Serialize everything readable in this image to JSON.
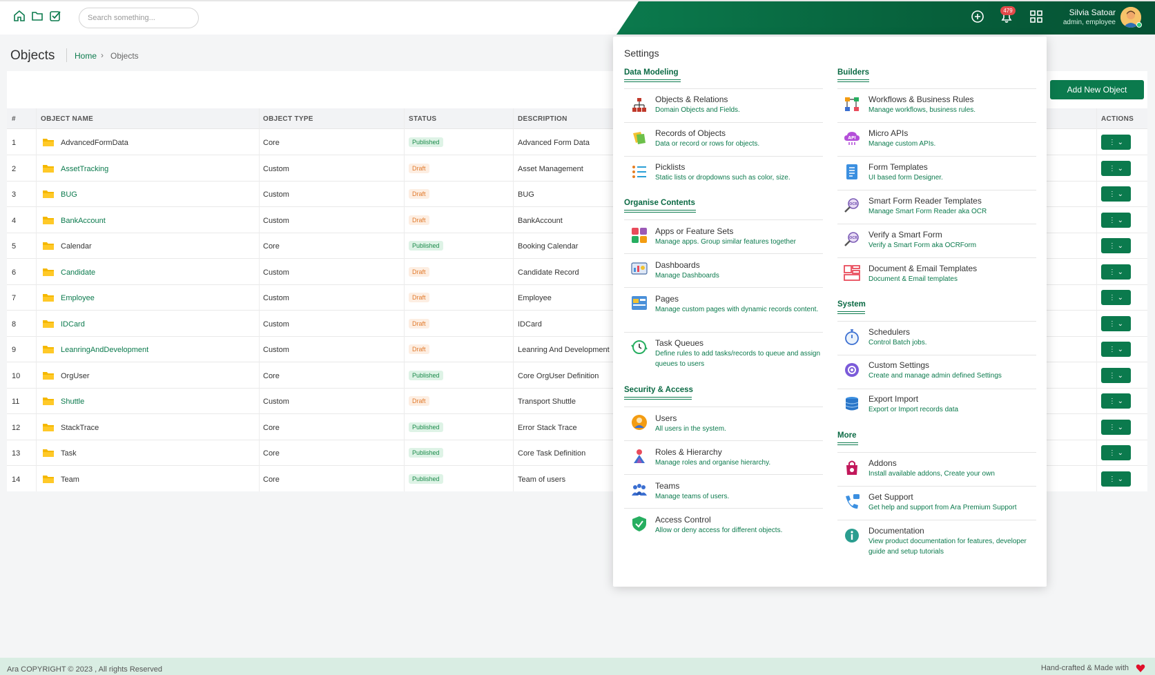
{
  "header": {
    "search_placeholder": "Search something...",
    "notification_count": "479",
    "user_name": "Silvia Satoar",
    "user_role": "admin, employee"
  },
  "page": {
    "title": "Objects",
    "breadcrumb_home": "Home",
    "breadcrumb_sep": "›",
    "breadcrumb_current": "Objects",
    "add_button": "Add New Object"
  },
  "table": {
    "columns": [
      "#",
      "OBJECT NAME",
      "OBJECT TYPE",
      "STATUS",
      "DESCRIPTION",
      "ACTIONS"
    ],
    "rows": [
      {
        "num": "1",
        "name": "AdvancedFormData",
        "type": "Core",
        "status": "Published",
        "desc": "Advanced Form Data"
      },
      {
        "num": "2",
        "name": "AssetTracking",
        "type": "Custom",
        "status": "Draft",
        "desc": "Asset Management"
      },
      {
        "num": "3",
        "name": "BUG",
        "type": "Custom",
        "status": "Draft",
        "desc": "BUG"
      },
      {
        "num": "4",
        "name": "BankAccount",
        "type": "Custom",
        "status": "Draft",
        "desc": "BankAccount"
      },
      {
        "num": "5",
        "name": "Calendar",
        "type": "Core",
        "status": "Published",
        "desc": "Booking Calendar"
      },
      {
        "num": "6",
        "name": "Candidate",
        "type": "Custom",
        "status": "Draft",
        "desc": "Candidate Record"
      },
      {
        "num": "7",
        "name": "Employee",
        "type": "Custom",
        "status": "Draft",
        "desc": "Employee"
      },
      {
        "num": "8",
        "name": "IDCard",
        "type": "Custom",
        "status": "Draft",
        "desc": "IDCard"
      },
      {
        "num": "9",
        "name": "LeanringAndDevelopment",
        "type": "Custom",
        "status": "Draft",
        "desc": "Leanring And Development"
      },
      {
        "num": "10",
        "name": "OrgUser",
        "type": "Core",
        "status": "Published",
        "desc": "Core OrgUser Definition"
      },
      {
        "num": "11",
        "name": "Shuttle",
        "type": "Custom",
        "status": "Draft",
        "desc": "Transport Shuttle"
      },
      {
        "num": "12",
        "name": "StackTrace",
        "type": "Core",
        "status": "Published",
        "desc": "Error Stack Trace"
      },
      {
        "num": "13",
        "name": "Task",
        "type": "Core",
        "status": "Published",
        "desc": "Core Task Definition"
      },
      {
        "num": "14",
        "name": "Team",
        "type": "Core",
        "status": "Published",
        "desc": "Team of users"
      }
    ],
    "action_label": "⋮ ⌄"
  },
  "settings": {
    "title": "Settings",
    "sections": {
      "data_modeling": "Data Modeling",
      "organise_contents": "Organise Contents",
      "security_access": "Security & Access",
      "builders": "Builders",
      "system": "System",
      "more": "More"
    },
    "items": {
      "objects_relations": {
        "title": "Objects & Relations",
        "desc": "Domain Objects and Fields."
      },
      "records_objects": {
        "title": "Records of Objects",
        "desc": "Data or record or rows for objects."
      },
      "picklists": {
        "title": "Picklists",
        "desc": "Static lists or dropdowns such as color, size."
      },
      "apps_features": {
        "title": "Apps or Feature Sets",
        "desc": "Manage apps. Group similar features together"
      },
      "dashboards": {
        "title": "Dashboards",
        "desc": "Manage Dashboards"
      },
      "pages": {
        "title": "Pages",
        "desc": "Manage custom pages with dynamic records content."
      },
      "task_queues": {
        "title": "Task Queues",
        "desc": "Define rules to add tasks/records to queue and assign queues to users"
      },
      "users": {
        "title": "Users",
        "desc": "All users in the system."
      },
      "roles": {
        "title": "Roles & Hierarchy",
        "desc": "Manage roles and organise hierarchy."
      },
      "teams": {
        "title": "Teams",
        "desc": "Manage teams of users."
      },
      "access_control": {
        "title": "Access Control",
        "desc": "Allow or deny access for different objects."
      },
      "workflows": {
        "title": "Workflows & Business Rules",
        "desc": "Manage workflows, business rules."
      },
      "micro_apis": {
        "title": "Micro APIs",
        "desc": "Manage custom APIs."
      },
      "form_templates": {
        "title": "Form Templates",
        "desc": "UI based form Designer."
      },
      "smart_form": {
        "title": "Smart Form Reader Templates",
        "desc": "Manage Smart Form Reader aka OCR"
      },
      "verify_smart_form": {
        "title": "Verify a Smart Form",
        "desc": "Verify a Smart Form aka OCRForm"
      },
      "doc_email": {
        "title": "Document & Email Templates",
        "desc": "Document & Email templates"
      },
      "schedulers": {
        "title": "Schedulers",
        "desc": "Control Batch jobs."
      },
      "custom_settings": {
        "title": "Custom Settings",
        "desc": "Create and manage admin defined Settings"
      },
      "export_import": {
        "title": "Export Import",
        "desc": "Export or Import records data"
      },
      "addons": {
        "title": "Addons",
        "desc": "Install available addons, Create your own"
      },
      "get_support": {
        "title": "Get Support",
        "desc": "Get help and support from Ara Premium Support"
      },
      "documentation": {
        "title": "Documentation",
        "desc": "View product documentation for features, developer guide and setup tutorials"
      }
    }
  },
  "footer": {
    "copyright": "Ara COPYRIGHT © 2023 , All rights Reserved",
    "made_with": "Hand-crafted & Made with"
  },
  "colors": {
    "brand_green": "#0b7a4d",
    "published_bg": "#def3e6",
    "draft_text": "#e07a2c"
  }
}
